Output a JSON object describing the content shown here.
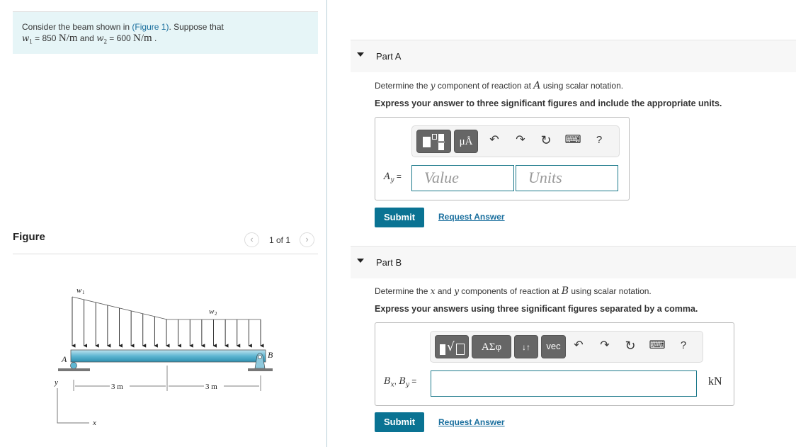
{
  "intro": {
    "line1_prefix": "Consider the beam shown in ",
    "figure_link": "(Figure 1)",
    "line1_suffix": ". Suppose that",
    "w1_sym": "w",
    "w1_sub": "1",
    "w1_eq": " = 850 ",
    "w1_unit": "N/m",
    "and": " and ",
    "w2_sym": "w",
    "w2_sub": "2",
    "w2_eq": " = 600 ",
    "w2_unit": "N/m",
    "end": " ."
  },
  "figure": {
    "title": "Figure",
    "pager": {
      "prev_icon": "‹",
      "text": "1 of 1",
      "next_icon": "›"
    },
    "labels": {
      "w1": "w",
      "w1_sub": "1",
      "w2": "w",
      "w2_sub": "2",
      "A": "A",
      "B": "B",
      "dim_left": "3 m",
      "dim_right": "3 m",
      "axis_y": "y",
      "axis_x": "x"
    }
  },
  "partA": {
    "label": "Part A",
    "prompt_pre": "Determine the ",
    "prompt_var": "y",
    "prompt_mid": " component of reaction at ",
    "prompt_var2": "A",
    "prompt_post": " using scalar notation.",
    "instruction": "Express your answer to three significant figures and include the appropriate units.",
    "toolbar": {
      "units_btn": "μÅ",
      "undo": "↶",
      "redo": "↷",
      "reset": "↻",
      "keyboard": "⌨",
      "help": "?"
    },
    "var_label": "A",
    "var_sub": "y",
    "equals": " =",
    "value_placeholder": "Value",
    "units_placeholder": "Units",
    "submit": "Submit",
    "request": "Request Answer"
  },
  "partB": {
    "label": "Part B",
    "prompt_pre": "Determine the ",
    "prompt_var": "x",
    "prompt_and": " and ",
    "prompt_var2": "y",
    "prompt_mid": " components of reaction at ",
    "prompt_var3": "B",
    "prompt_post": " using scalar notation.",
    "instruction": "Express your answers using three significant figures separated by a comma.",
    "toolbar": {
      "greek_btn": "ΑΣφ",
      "arrows_btn": "↓↑",
      "vec_btn": "vec",
      "undo": "↶",
      "redo": "↷",
      "reset": "↻",
      "keyboard": "⌨",
      "help": "?"
    },
    "var_label": "B",
    "var_sub1": "x",
    "sep": ", ",
    "var_label2": "B",
    "var_sub2": "y",
    "equals": " =",
    "input_value": "",
    "unit": "kN",
    "submit": "Submit",
    "request": "Request Answer"
  }
}
